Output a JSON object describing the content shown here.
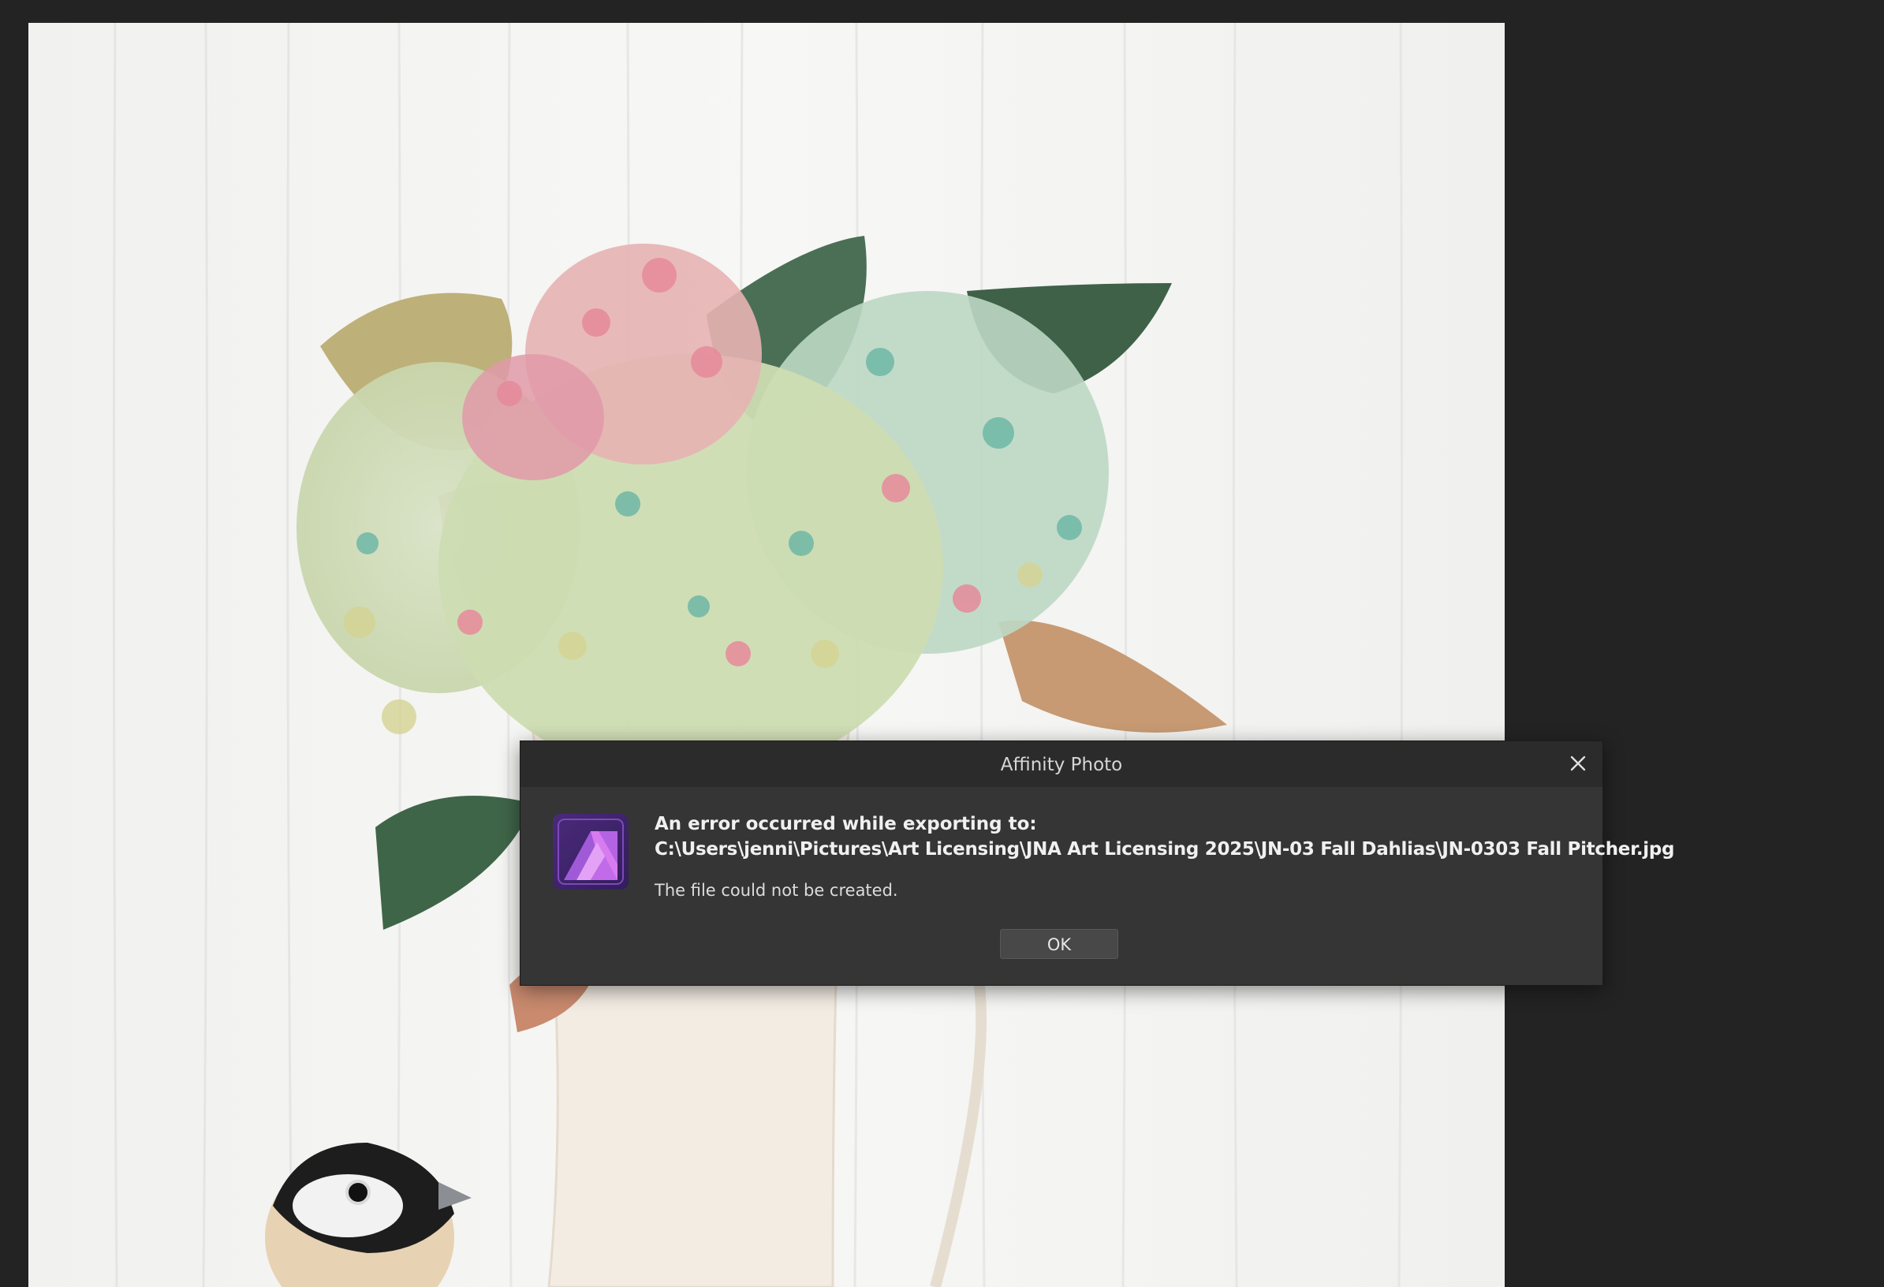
{
  "dialog": {
    "title": "Affinity Photo",
    "heading": "An error occurred while exporting to:",
    "path": "C:\\Users\\jenni\\Pictures\\Art Licensing\\JNA Art Licensing 2025\\JN-03 Fall Dahlias\\JN-0303 Fall Pitcher.jpg",
    "detail": "The file could not be created.",
    "ok_label": "OK",
    "icons": {
      "close": "close-icon",
      "app": "affinity-photo-icon"
    }
  },
  "colors": {
    "workspace_bg": "#232323",
    "dialog_bg": "#353535",
    "titlebar_bg": "#2b2b2b",
    "icon_purple": "#7a3ab8",
    "icon_light": "#d77cf0"
  }
}
